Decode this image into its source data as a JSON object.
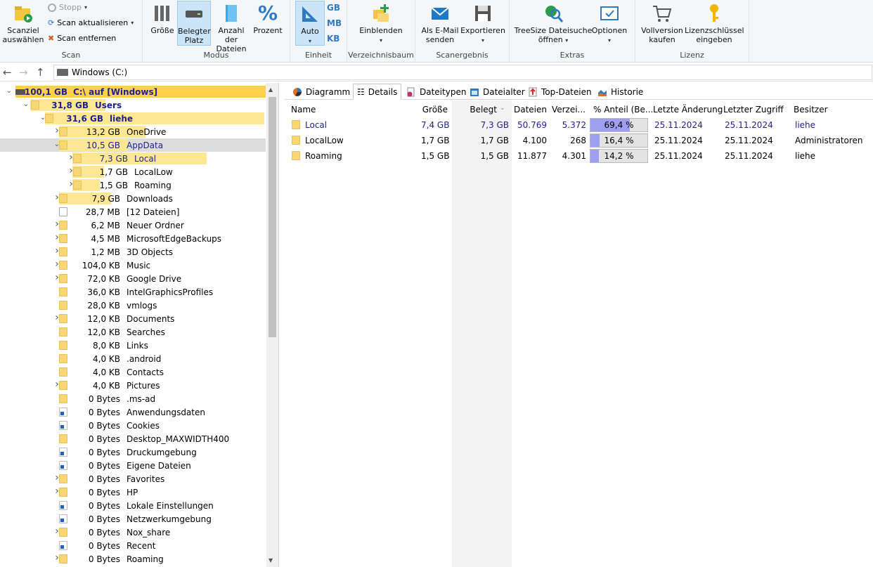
{
  "ribbon": {
    "scan": {
      "select_target": "Scanziel auswählen",
      "stop": "Stopp",
      "refresh": "Scan aktualisieren",
      "remove": "Scan entfernen",
      "group": "Scan"
    },
    "mode": {
      "size": "Größe",
      "allocated": "Belegter Platz",
      "count": "Anzahl der Dateien",
      "percent": "Prozent",
      "group": "Modus"
    },
    "unit": {
      "auto": "Auto",
      "gb": "GB",
      "mb": "MB",
      "kb": "KB",
      "group": "Einheit"
    },
    "dirtree": {
      "show": "Einblenden",
      "group": "Verzeichnisbaum"
    },
    "result": {
      "email": "Als E-Mail senden",
      "export": "Exportieren",
      "group": "Scanergebnis"
    },
    "extras": {
      "search": "TreeSize Dateisuche öffnen",
      "options": "Optionen",
      "group": "Extras"
    },
    "license": {
      "buy": "Vollversion kaufen",
      "key": "Lizenzschlüssel eingeben",
      "group": "Lizenz"
    }
  },
  "address": {
    "path": "Windows (C:)"
  },
  "tree": [
    {
      "size": "100,1 GB",
      "name": "C:\\  auf  [Windows]",
      "level": 0,
      "bar": 1.0,
      "bold": true,
      "expanded": true,
      "icon": "drive"
    },
    {
      "size": "31,8 GB",
      "name": "Users",
      "level": 1,
      "bar": 0.318,
      "bold": true,
      "expanded": true,
      "icon": "folder"
    },
    {
      "size": "31,6 GB",
      "name": "liehe",
      "level": 2,
      "bar": 0.994,
      "bold": true,
      "expanded": true,
      "icon": "folder"
    },
    {
      "size": "13,2 GB",
      "name": "OneDrive",
      "level": 3,
      "bar": 0.418,
      "collapsed": true,
      "icon": "folder"
    },
    {
      "size": "10,5 GB",
      "name": "AppData",
      "level": 3,
      "bar": 0.332,
      "expanded": true,
      "selected": true,
      "blue": true,
      "icon": "folder"
    },
    {
      "size": "7,3 GB",
      "name": "Local",
      "level": 4,
      "bar": 0.694,
      "collapsed": true,
      "blue": true,
      "icon": "folder"
    },
    {
      "size": "1,7 GB",
      "name": "LocalLow",
      "level": 4,
      "bar": 0.164,
      "collapsed": true,
      "icon": "folder"
    },
    {
      "size": "1,5 GB",
      "name": "Roaming",
      "level": 4,
      "bar": 0.142,
      "collapsed": true,
      "icon": "folder"
    },
    {
      "size": "7,9 GB",
      "name": "Downloads",
      "level": 3,
      "bar": 0.25,
      "collapsed": true,
      "icon": "folder"
    },
    {
      "size": "28,7 MB",
      "name": "[12 Dateien]",
      "level": 3,
      "bar": 0.0,
      "icon": "file"
    },
    {
      "size": "6,2 MB",
      "name": "Neuer Ordner",
      "level": 3,
      "bar": 0.0,
      "collapsed": true,
      "icon": "folder"
    },
    {
      "size": "4,5 MB",
      "name": "MicrosoftEdgeBackups",
      "level": 3,
      "bar": 0.0,
      "collapsed": true,
      "icon": "folder"
    },
    {
      "size": "1,2 MB",
      "name": "3D Objects",
      "level": 3,
      "bar": 0.0,
      "collapsed": true,
      "icon": "folder"
    },
    {
      "size": "104,0 KB",
      "name": "Music",
      "level": 3,
      "bar": 0.0,
      "collapsed": true,
      "icon": "folder"
    },
    {
      "size": "72,0 KB",
      "name": "Google Drive",
      "level": 3,
      "bar": 0.0,
      "collapsed": true,
      "icon": "folder"
    },
    {
      "size": "36,0 KB",
      "name": "IntelGraphicsProfiles",
      "level": 3,
      "bar": 0.0,
      "icon": "folder"
    },
    {
      "size": "28,0 KB",
      "name": "vmlogs",
      "level": 3,
      "bar": 0.0,
      "icon": "folder"
    },
    {
      "size": "12,0 KB",
      "name": "Documents",
      "level": 3,
      "bar": 0.0,
      "collapsed": true,
      "icon": "folder"
    },
    {
      "size": "12,0 KB",
      "name": "Searches",
      "level": 3,
      "bar": 0.0,
      "icon": "folder"
    },
    {
      "size": "8,0 KB",
      "name": "Links",
      "level": 3,
      "bar": 0.0,
      "icon": "folder"
    },
    {
      "size": "4,0 KB",
      "name": ".android",
      "level": 3,
      "bar": 0.0,
      "icon": "folder"
    },
    {
      "size": "4,0 KB",
      "name": "Contacts",
      "level": 3,
      "bar": 0.0,
      "icon": "folder"
    },
    {
      "size": "4,0 KB",
      "name": "Pictures",
      "level": 3,
      "bar": 0.0,
      "collapsed": true,
      "icon": "folder"
    },
    {
      "size": "0 Bytes",
      "name": ".ms-ad",
      "level": 3,
      "bar": 0.0,
      "icon": "folder"
    },
    {
      "size": "0 Bytes",
      "name": "Anwendungsdaten",
      "level": 3,
      "bar": 0.0,
      "icon": "link"
    },
    {
      "size": "0 Bytes",
      "name": "Cookies",
      "level": 3,
      "bar": 0.0,
      "icon": "link"
    },
    {
      "size": "0 Bytes",
      "name": "Desktop_MAXWIDTH400",
      "level": 3,
      "bar": 0.0,
      "icon": "folder"
    },
    {
      "size": "0 Bytes",
      "name": "Druckumgebung",
      "level": 3,
      "bar": 0.0,
      "icon": "link"
    },
    {
      "size": "0 Bytes",
      "name": "Eigene Dateien",
      "level": 3,
      "bar": 0.0,
      "icon": "link"
    },
    {
      "size": "0 Bytes",
      "name": "Favorites",
      "level": 3,
      "bar": 0.0,
      "collapsed": true,
      "icon": "folder"
    },
    {
      "size": "0 Bytes",
      "name": "HP",
      "level": 3,
      "bar": 0.0,
      "collapsed": true,
      "icon": "folder"
    },
    {
      "size": "0 Bytes",
      "name": "Lokale Einstellungen",
      "level": 3,
      "bar": 0.0,
      "icon": "link"
    },
    {
      "size": "0 Bytes",
      "name": "Netzwerkumgebung",
      "level": 3,
      "bar": 0.0,
      "icon": "link"
    },
    {
      "size": "0 Bytes",
      "name": "Nox_share",
      "level": 3,
      "bar": 0.0,
      "collapsed": true,
      "icon": "folder"
    },
    {
      "size": "0 Bytes",
      "name": "Recent",
      "level": 3,
      "bar": 0.0,
      "icon": "link"
    },
    {
      "size": "0 Bytes",
      "name": "Roaming",
      "level": 3,
      "bar": 0.0,
      "collapsed": true,
      "icon": "folder"
    }
  ],
  "tabs": [
    "Diagramm",
    "Details",
    "Dateitypen",
    "Dateialter",
    "Top-Dateien",
    "Historie"
  ],
  "table": {
    "headers": [
      "Name",
      "Größe",
      "Belegt",
      "Dateien",
      "Verzei...",
      "% Anteil (Be...",
      "Letzte Änderung",
      "Letzter Zugriff",
      "Besitzer"
    ],
    "rows": [
      {
        "name": "Local",
        "size": "7,4 GB",
        "alloc": "7,3 GB",
        "files": "50.769",
        "dirs": "5.372",
        "pct_label": "69,4 %",
        "pct": 69.4,
        "modified": "25.11.2024",
        "accessed": "25.11.2024",
        "owner": "liehe",
        "blue": true
      },
      {
        "name": "LocalLow",
        "size": "1,7 GB",
        "alloc": "1,7 GB",
        "files": "4.100",
        "dirs": "268",
        "pct_label": "16,4 %",
        "pct": 16.4,
        "modified": "25.11.2024",
        "accessed": "25.11.2024",
        "owner": "Administratoren"
      },
      {
        "name": "Roaming",
        "size": "1,5 GB",
        "alloc": "1,5 GB",
        "files": "11.877",
        "dirs": "4.301",
        "pct_label": "14,2 %",
        "pct": 14.2,
        "modified": "25.11.2024",
        "accessed": "25.11.2024",
        "owner": "liehe"
      }
    ]
  },
  "colors": {
    "tree_bar": "#fde793",
    "tree_bar_root": "#fdd24a",
    "pct_fill": "#9f9ff2",
    "accent": "#1f1f8f"
  }
}
